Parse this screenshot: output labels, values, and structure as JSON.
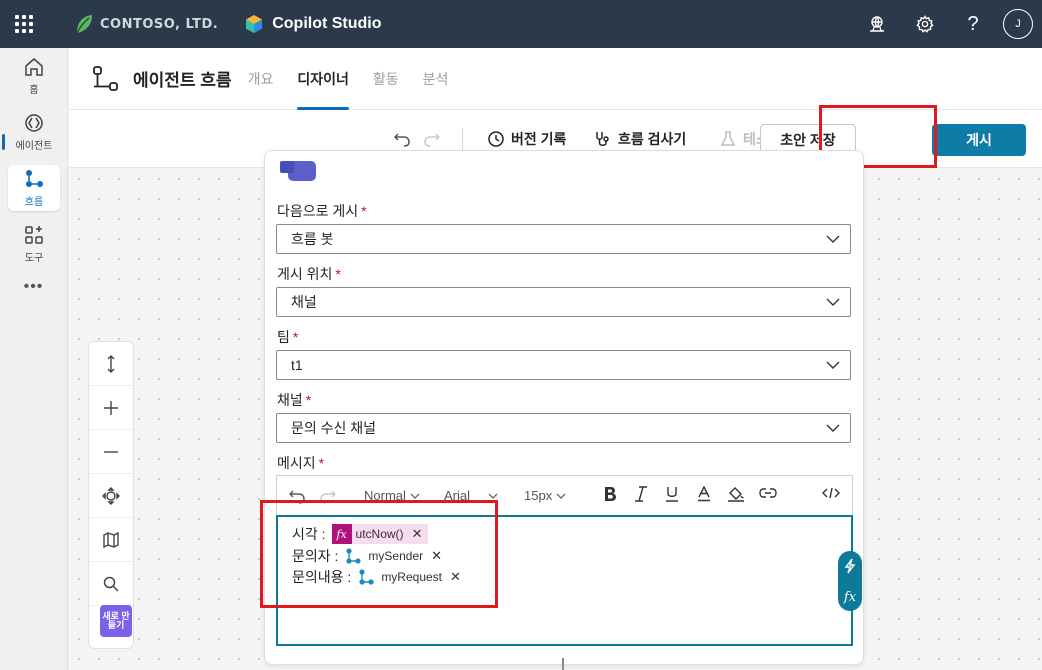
{
  "topbar": {
    "brand": "CONTOSO, LTD.",
    "app_title": "Copilot Studio",
    "avatar_initial": "J"
  },
  "rail": {
    "items": [
      {
        "label": "홈",
        "icon": "home-icon"
      },
      {
        "label": "에이전트",
        "icon": "agent-icon"
      },
      {
        "label": "흐름",
        "icon": "flow-icon"
      },
      {
        "label": "도구",
        "icon": "tools-icon"
      }
    ],
    "more": "•••"
  },
  "header": {
    "title": "에이전트 흐름",
    "tabs": [
      {
        "label": "개요"
      },
      {
        "label": "디자이너"
      },
      {
        "label": "활동"
      },
      {
        "label": "분석"
      }
    ]
  },
  "toolbar": {
    "version_history": "버전 기록",
    "flow_checker": "흐름 검사기",
    "test": "테스트",
    "save_draft": "초안 저장",
    "publish": "게시"
  },
  "form": {
    "post_as": {
      "label": "다음으로 게시",
      "value": "흐름 봇"
    },
    "post_in": {
      "label": "게시 위치",
      "value": "채널"
    },
    "team": {
      "label": "팀",
      "value": "t1"
    },
    "channel": {
      "label": "채널",
      "value": "문의 수신 채널"
    },
    "message": {
      "label": "메시지"
    },
    "required_mark": "*"
  },
  "editor": {
    "style": "Normal",
    "font": "Arial",
    "size": "15px",
    "lines": [
      {
        "label": "시각 :",
        "token": "utcNow()",
        "token_type": "function"
      },
      {
        "label": "문의자 :",
        "token": "mySender",
        "token_type": "variable"
      },
      {
        "label": "문의내용 :",
        "token": "myRequest",
        "token_type": "variable"
      }
    ]
  },
  "canvas": {
    "new_badge": "새로 만들기"
  },
  "colors": {
    "topbar": "#2b3a4a",
    "accent": "#0f6cbd",
    "publish": "#0f7ba7",
    "highlight": "#e0191f",
    "fx": "#b0127a"
  }
}
